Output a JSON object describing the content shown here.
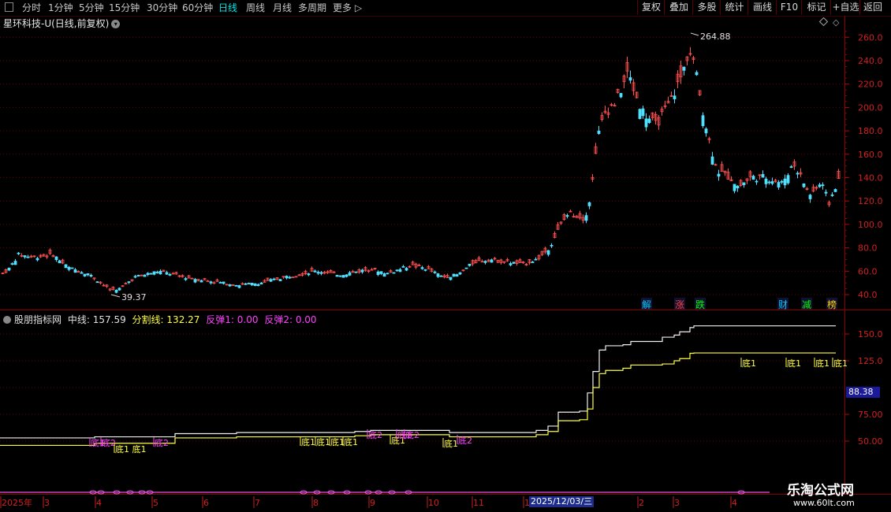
{
  "toolbar": {
    "periods": [
      "分时",
      "1分钟",
      "5分钟",
      "15分钟",
      "30分钟",
      "60分钟",
      "日线",
      "周线",
      "月线",
      "多周期",
      "更多"
    ],
    "active_period": "日线",
    "right_buttons": [
      "复权",
      "叠加",
      "多股",
      "统计",
      "画线",
      "F10",
      "标记",
      "+自选",
      "返回"
    ]
  },
  "stock": {
    "title": "星环科技-U(日线,前复权)",
    "high_label": "264.88",
    "low_label": "39.37"
  },
  "price_axis": {
    "ticks": [
      "260.0",
      "240.0",
      "220.0",
      "200.0",
      "180.0",
      "160.0",
      "140.0",
      "120.0",
      "100.0",
      "80.0",
      "60.0",
      "40.0"
    ]
  },
  "markers": [
    {
      "text": "解",
      "color": "#00c8ff"
    },
    {
      "text": "涨",
      "color": "#ff4040"
    },
    {
      "text": "跌",
      "color": "#00ff00"
    },
    {
      "text": "财",
      "color": "#00c8ff"
    },
    {
      "text": "减",
      "color": "#00ff00"
    },
    {
      "text": "榜",
      "color": "#ffd000"
    }
  ],
  "indicator": {
    "name": "股朋指标网",
    "mid_label": "中线:",
    "mid_value": "157.59",
    "split_label": "分割线:",
    "split_value": "132.27",
    "rb1_label": "反弹1:",
    "rb1_value": "0.00",
    "rb2_label": "反弹2:",
    "rb2_value": "0.00",
    "last_value": "88.38",
    "axis_ticks": [
      "150.0",
      "125.0",
      "75.00",
      "50.00"
    ],
    "signals": [
      "底1",
      "底2",
      "底1 底1",
      "底2",
      "底1",
      "底1",
      "底1",
      "底1",
      "底2",
      "底1",
      "底1",
      "底2",
      "底1",
      "底2",
      "底1",
      "底1",
      "底1",
      "底1"
    ]
  },
  "date_axis": {
    "labels": [
      "2025年",
      "3",
      "4",
      "5",
      "6",
      "7",
      "8",
      "9",
      "10",
      "11",
      "1",
      "2",
      "3",
      "4"
    ],
    "highlight": "2025/12/03/三"
  },
  "watermark": {
    "main": "乐淘公式网",
    "sub": "www.60lt.com"
  }
}
